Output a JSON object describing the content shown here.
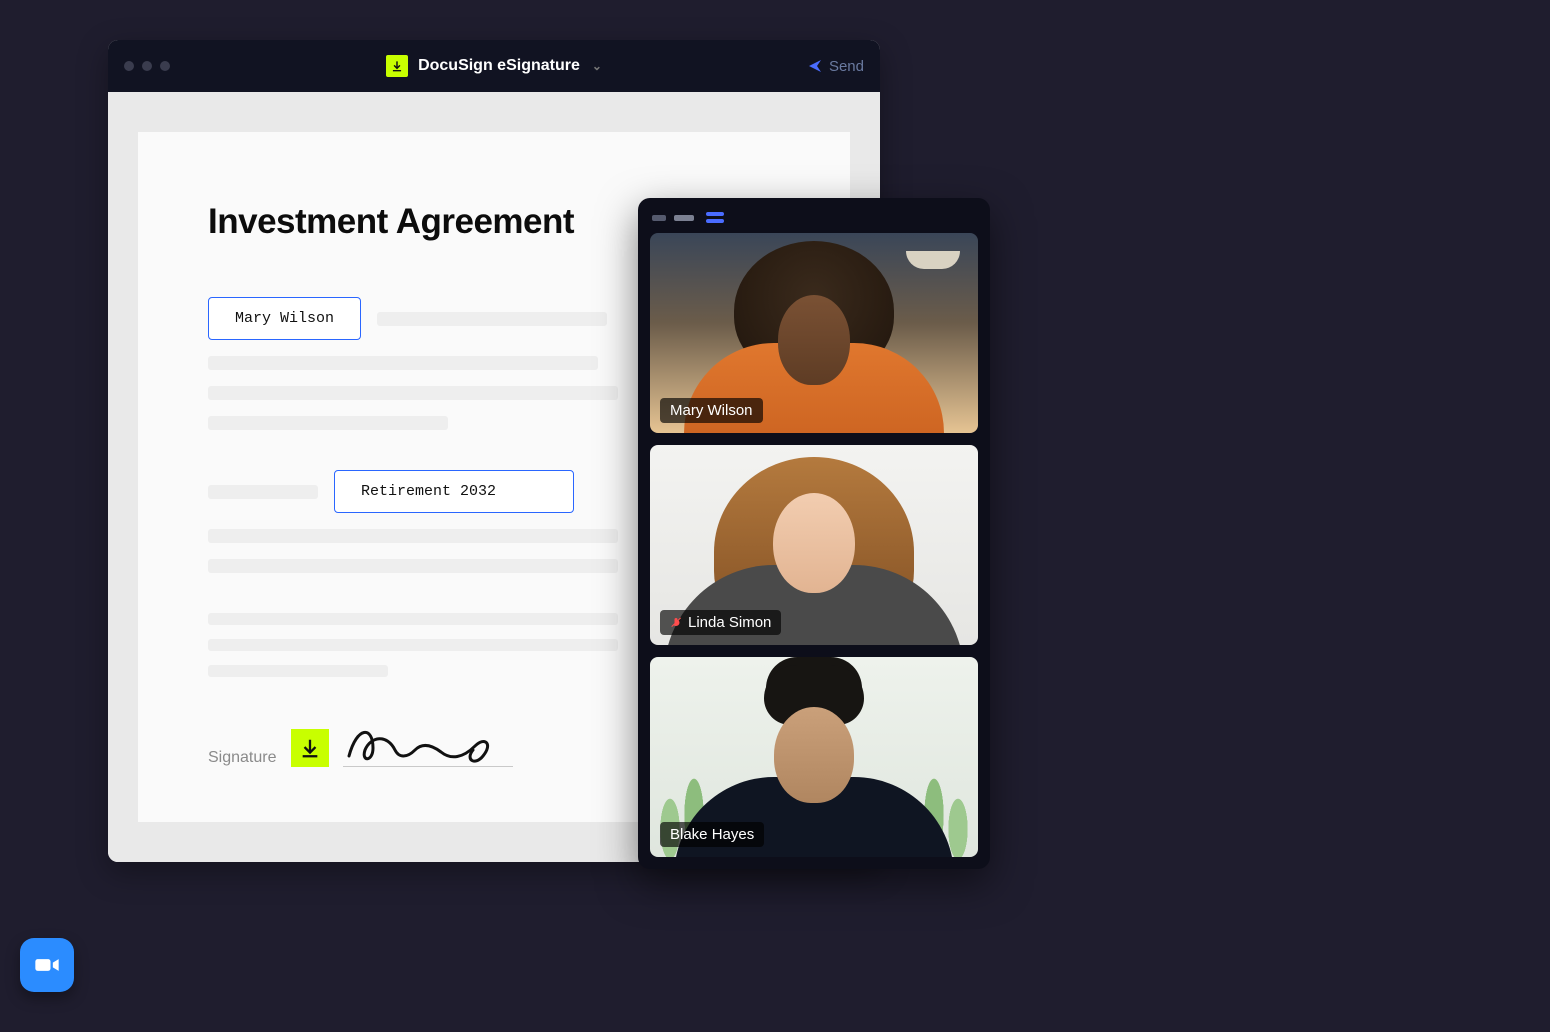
{
  "docWindow": {
    "appTitle": "DocuSign eSignature",
    "sendLabel": "Send"
  },
  "document": {
    "heading": "Investment Agreement",
    "field1": "Mary Wilson",
    "field2": "Retirement 2032",
    "signatureLabel": "Signature"
  },
  "videoCall": {
    "participants": [
      {
        "name": "Mary Wilson",
        "muted": false
      },
      {
        "name": "Linda Simon",
        "muted": true
      },
      {
        "name": "Blake Hayes",
        "muted": false
      }
    ]
  },
  "icons": {
    "docusignMark": "download-arrow-icon",
    "zoom": "video-camera-icon"
  },
  "colors": {
    "accentLime": "#c8ff00",
    "accentBlue": "#2a66ff",
    "zoomBlue": "#2b8cff",
    "pageBg": "#1f1d2e"
  }
}
